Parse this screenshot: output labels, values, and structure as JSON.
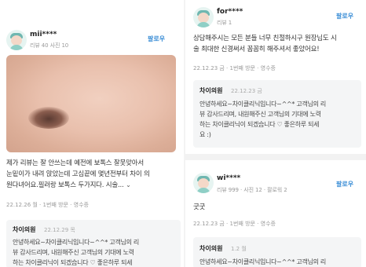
{
  "left": {
    "username": "mii****",
    "meta": "리뷰 40  사진 10",
    "follow": "팔로우",
    "body": [
      "제가 리뷰는 잘 안쓰는데 예전에 보톡스 잘못맞아서",
      "눈밑이가 내려 앉았는데 고심끝에 몇년전부터 차이 의",
      "원다녀어요.필러랑 보톡스 두가지다. 시술..."
    ],
    "more": "⌄",
    "footer": "22.12.26 월  ·  1번째 방문  ·  영수증",
    "reply": {
      "name": "차이의원",
      "date": "22.12.29 목",
      "lines": [
        "안녕하세요~차이클리닉입니다~^^* 고객님의 리",
        "뷰 감사드리며, 내원해주신 고객님의 기대에 노력",
        "하는 차이클리닉이 되겠습니다 ♡ 좋은하루 되세"
      ]
    }
  },
  "right_top": {
    "username": "for****",
    "meta": "리뷰 1",
    "follow": "팔로우",
    "body": [
      "상담해주시는 모든 분들 너무 친절하시구 원장님도 시",
      "술 최대한 신경써서 꼼꼼히 해주셔서 좋았어요!"
    ],
    "footer": "22.12.23 금  ·  1번째 방문  ·  영수증",
    "reply": {
      "name": "차이의원",
      "date": "22.12.23 금",
      "lines": [
        "안녕하세요~차이클리닉입니다~^^* 고객님의 리",
        "뷰 감사드리며, 내원해주신 고객님의 기대에 노력",
        "하는 차이클리닉이 되겠습니다 ♡ 좋은하루 되세",
        "요 :)"
      ]
    }
  },
  "right_bottom": {
    "username": "wi****",
    "meta": "리뷰 999  ·  사진 12  ·  팔로워 2",
    "follow": "팔로우",
    "body": [
      "굿굿"
    ],
    "footer": "22.12.23 금  ·  1번째 방문  ·  영수증",
    "reply": {
      "name": "차이의원",
      "date": "1.2 월",
      "lines": [
        "안녕하세요~차이클리닉입니다~^^* 고객님의 리"
      ]
    }
  }
}
